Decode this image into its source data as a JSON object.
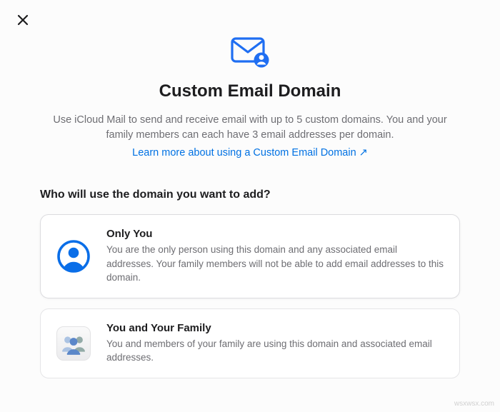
{
  "header": {
    "title": "Custom Email Domain",
    "description": "Use iCloud Mail to send and receive email with up to 5 custom domains. You and your family members can each have 3 email addresses per domain.",
    "learn_more_label": "Learn more about using a Custom Email Domain ↗"
  },
  "question": "Who will use the domain you want to add?",
  "options": [
    {
      "title": "Only You",
      "description": "You are the only person using this domain and any associated email addresses. Your family members will not be able to add email addresses to this domain."
    },
    {
      "title": "You and Your Family",
      "description": "You and members of your family are using this domain and associated email addresses."
    }
  ],
  "watermark": "wsxwsx.com"
}
